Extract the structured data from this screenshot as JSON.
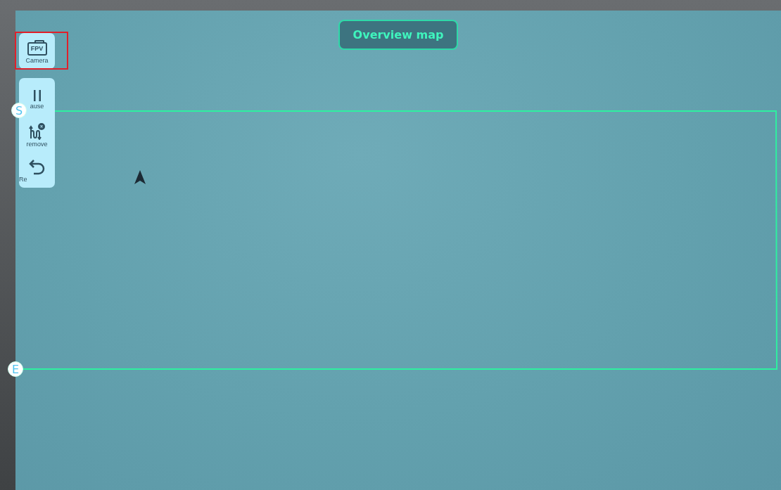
{
  "header": {
    "title": "Overview map"
  },
  "toolbar": {
    "camera": {
      "icon_text": "FPV",
      "label": "Camera",
      "highlighted": true
    },
    "actions": [
      {
        "kind": "pause",
        "label": "ause"
      },
      {
        "kind": "remove",
        "label": "remove"
      },
      {
        "kind": "return",
        "label": "Re"
      }
    ]
  },
  "route": {
    "start": "S",
    "end": "E"
  }
}
